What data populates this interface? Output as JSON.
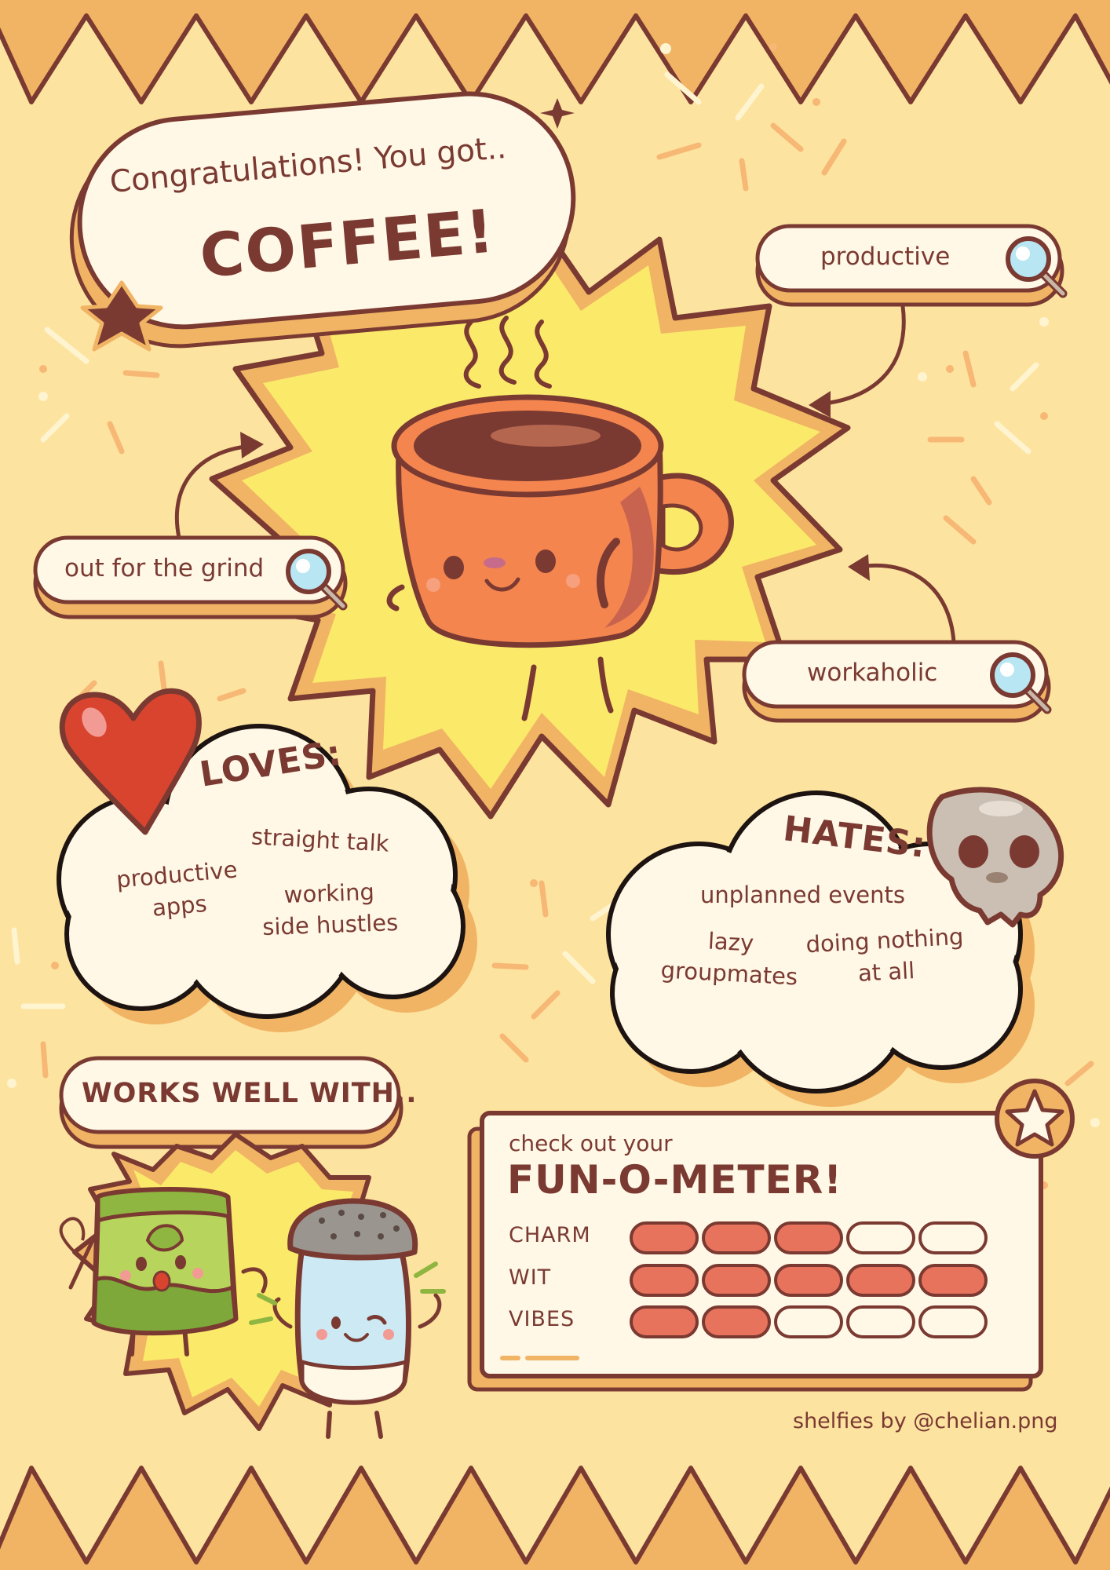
{
  "header": {
    "intro": "Congratulations! You got..",
    "result": "COFFEE!"
  },
  "traits": [
    {
      "label": "productive",
      "icon": "magnifier-icon"
    },
    {
      "label": "out for the grind",
      "icon": "magnifier-icon"
    },
    {
      "label": "workaholic",
      "icon": "magnifier-icon"
    }
  ],
  "loves": {
    "title": "LOVES:",
    "icon": "heart-icon",
    "items": [
      "straight talk",
      "productive\napps",
      "working\nside hustles"
    ]
  },
  "hates": {
    "title": "HATES:",
    "icon": "skull-icon",
    "items": [
      "unplanned events",
      "lazy\ngroupmates",
      "doing nothing\nat all"
    ]
  },
  "works_well_with": {
    "title": "WORKS WELL WITH..",
    "companions": [
      "matcha-pouch-character",
      "salt-shaker-character"
    ]
  },
  "fun_o_meter": {
    "intro": "check out your",
    "title": "FUN-O-METER!",
    "max": 5,
    "rows": [
      {
        "label": "CHARM",
        "value": 3
      },
      {
        "label": "WIT",
        "value": 5
      },
      {
        "label": "VIBES",
        "value": 2
      }
    ]
  },
  "credit": "shelfies by @chelian.png",
  "colors": {
    "background": "#fde3a0",
    "border_stripe": "#f0b464",
    "outline": "#7a3a32",
    "panel": "#fff8e6",
    "burst": "#fbe96a",
    "mug": "#f4854e",
    "meter_fill": "#e8735c",
    "heart": "#d9442f"
  }
}
